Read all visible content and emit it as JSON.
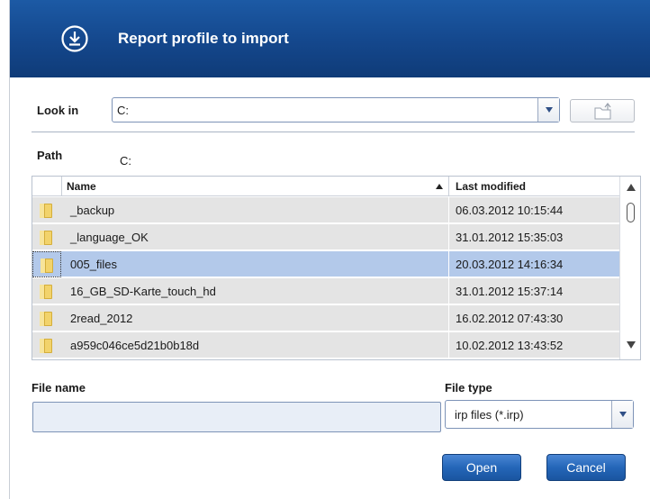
{
  "dialog": {
    "title": "Report profile to import",
    "icon": "download-circle-icon",
    "header_color": "#14478c"
  },
  "look_in": {
    "label": "Look in",
    "value": "C:"
  },
  "path": {
    "label": "Path",
    "value": "C:"
  },
  "file_list": {
    "columns": [
      "Name",
      "Last modified"
    ],
    "sort_column": "Name",
    "sort_direction": "ascending",
    "rows": [
      {
        "name": "_backup",
        "modified": "06.03.2012 10:15:44",
        "selected": false
      },
      {
        "name": "_language_OK",
        "modified": "31.01.2012 15:35:03",
        "selected": false
      },
      {
        "name": "005_files",
        "modified": "20.03.2012 14:16:34",
        "selected": true
      },
      {
        "name": "16_GB_SD-Karte_touch_hd",
        "modified": "31.01.2012 15:37:14",
        "selected": false
      },
      {
        "name": "2read_2012",
        "modified": "16.02.2012 07:43:30",
        "selected": false
      },
      {
        "name": "a959c046ce5d21b0b18d",
        "modified": "10.02.2012 13:43:52",
        "selected": false
      }
    ]
  },
  "file_name": {
    "label": "File name",
    "value": ""
  },
  "file_type": {
    "label": "File type",
    "value": "irp files (*.irp)"
  },
  "buttons": {
    "open": "Open",
    "cancel": "Cancel"
  },
  "colors": {
    "selected_row": "#b3c9ea",
    "row": "#e4e4e4",
    "button": "#2466b8"
  }
}
